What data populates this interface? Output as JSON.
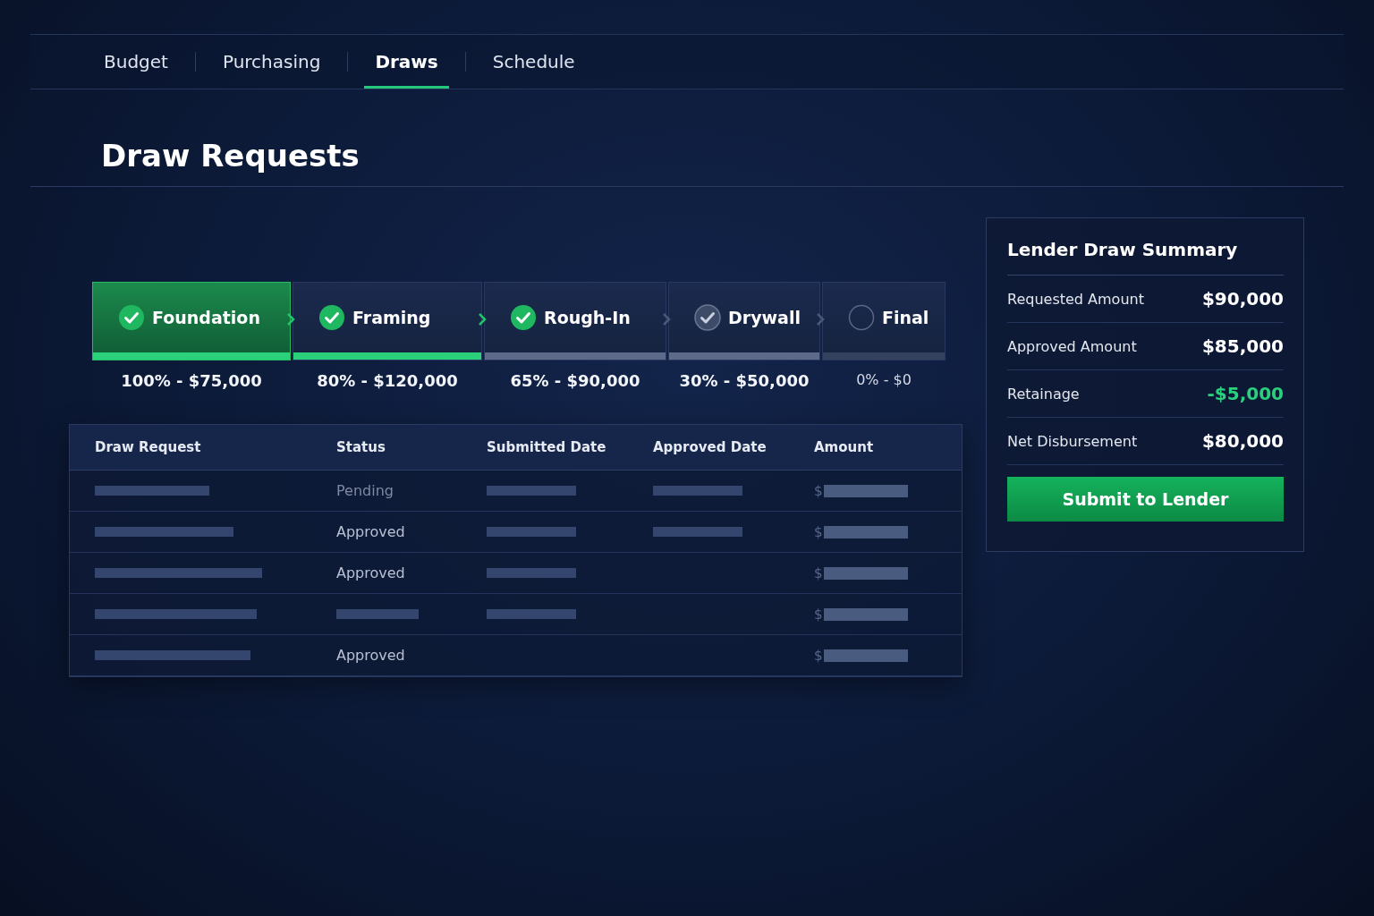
{
  "tabs": [
    {
      "label": "Budget",
      "selected": false
    },
    {
      "label": "Purchasing",
      "selected": false
    },
    {
      "label": "Draws",
      "selected": true
    },
    {
      "label": "Schedule",
      "selected": false
    }
  ],
  "title": "Draw Requests",
  "stages": [
    {
      "label": "Foundation",
      "kind": "done",
      "funded": true,
      "selected": true,
      "caption": "100% - $75,000"
    },
    {
      "label": "Framing",
      "kind": "done",
      "funded": true,
      "selected": false,
      "caption": "80% - $120,000"
    },
    {
      "label": "Rough-In",
      "kind": "done",
      "funded": false,
      "selected": false,
      "caption": "65% - $90,000"
    },
    {
      "label": "Drywall",
      "kind": "review",
      "funded": false,
      "selected": false,
      "caption": "30% - $50,000"
    },
    {
      "label": "Final",
      "kind": "open",
      "funded": false,
      "selected": false,
      "caption": "0% - $0"
    }
  ],
  "table": {
    "columns": [
      "Draw Request",
      "Status",
      "Submitted Date",
      "Approved Date",
      "Amount"
    ],
    "rows": [
      {
        "cells": [
          {
            "kind": "skeleton"
          },
          {
            "kind": "text",
            "text": "Pending",
            "muted": true
          },
          {
            "kind": "skeleton"
          },
          {
            "kind": "skeleton"
          },
          {
            "kind": "amount",
            "text": "$"
          }
        ]
      },
      {
        "cells": [
          {
            "kind": "skeleton"
          },
          {
            "kind": "text",
            "text": "Approved",
            "muted": false
          },
          {
            "kind": "skeleton"
          },
          {
            "kind": "skeleton"
          },
          {
            "kind": "amount",
            "text": "$"
          }
        ]
      },
      {
        "cells": [
          {
            "kind": "skeleton"
          },
          {
            "kind": "text",
            "text": "Approved",
            "muted": false
          },
          {
            "kind": "skeleton"
          },
          {
            "kind": "blank"
          },
          {
            "kind": "amount",
            "text": "$"
          }
        ]
      },
      {
        "cells": [
          {
            "kind": "skeleton"
          },
          {
            "kind": "skeleton"
          },
          {
            "kind": "skeleton"
          },
          {
            "kind": "blank"
          },
          {
            "kind": "amount",
            "text": "$"
          }
        ]
      },
      {
        "cells": [
          {
            "kind": "skeleton"
          },
          {
            "kind": "text",
            "text": "Approved",
            "muted": false
          },
          {
            "kind": "blank"
          },
          {
            "kind": "blank"
          },
          {
            "kind": "amount",
            "text": "$"
          }
        ]
      }
    ]
  },
  "summary": {
    "title": "Lender Draw Summary",
    "rows": [
      {
        "label": "Requested Amount",
        "value": "$90,000",
        "positive": false
      },
      {
        "label": "Approved Amount",
        "value": "$85,000",
        "positive": false
      },
      {
        "label": "Retainage",
        "value": "-$5,000",
        "positive": true
      },
      {
        "label": "Net Disbursement",
        "value": "$80,000",
        "positive": false
      }
    ],
    "button": "Submit to Lender"
  }
}
